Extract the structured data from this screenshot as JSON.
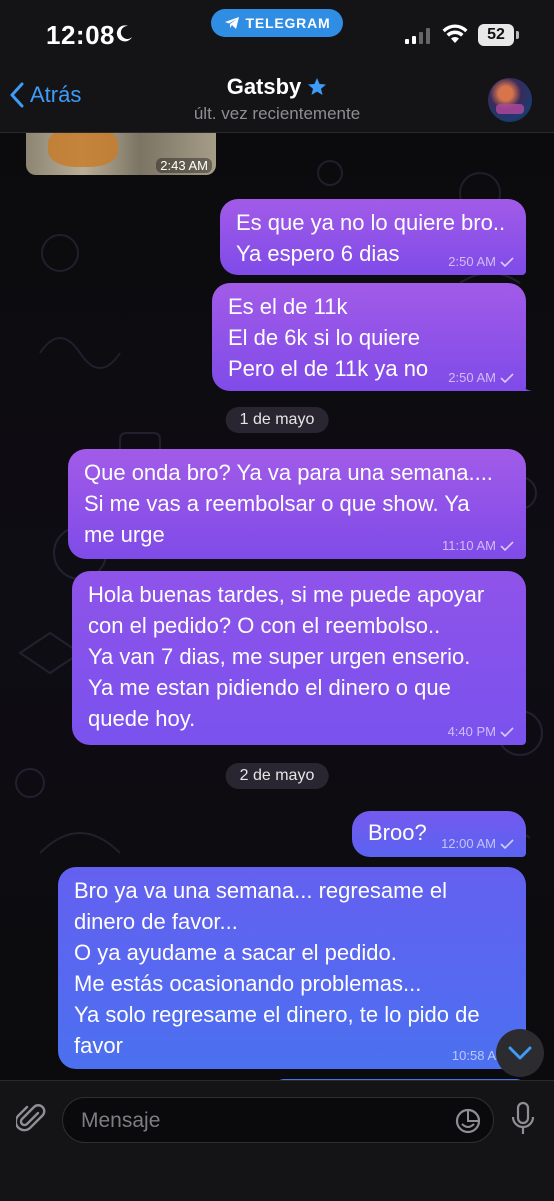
{
  "status_bar": {
    "time": "12:08",
    "telegram_pill": "TELEGRAM",
    "battery": "52"
  },
  "header": {
    "back_label": "Atrás",
    "title": "Gatsby",
    "subtitle": "últ. vez recientemente"
  },
  "photo_message": {
    "time": "2:43 AM"
  },
  "messages": [
    {
      "side": "out",
      "lines": [
        "Es que ya no lo quiere bro..",
        "Ya espero 6 dias"
      ],
      "time": "2:50 AM"
    },
    {
      "side": "out",
      "lines": [
        "Es el de 11k",
        "El de 6k si lo quiere",
        "Pero el de 11k ya no"
      ],
      "time": "2:50 AM"
    },
    {
      "side": "out",
      "lines": [
        "Que onda bro? Ya va para una semana....",
        "Si me vas a reembolsar o que show. Ya",
        "me urge"
      ],
      "time": "11:10 AM"
    },
    {
      "side": "out",
      "lines": [
        "Hola buenas tardes, si me puede apoyar",
        "con el pedido? O con el reembolso..",
        "Ya van 7 dias, me super urgen enserio.",
        "Ya me estan pidiendo el dinero o que",
        "quede hoy."
      ],
      "time": "4:40 PM"
    },
    {
      "side": "out",
      "lines": [
        "Broo?"
      ],
      "time": "12:00 AM"
    },
    {
      "side": "out",
      "lines": [
        "Bro ya va una semana... regresame el",
        "dinero de favor...",
        "O ya ayudame a sacar el pedido.",
        "Me estás ocasionando problemas...",
        "Ya solo regresame el dinero, te lo pido de",
        "favor"
      ],
      "time": "10:58 A"
    }
  ],
  "dates": {
    "d1": "1 de mayo",
    "d2": "2 de mayo"
  },
  "input": {
    "placeholder": "Mensaje"
  },
  "colors": {
    "accent": "#3e9bf7",
    "bubble_purple": "#8f53e9",
    "bubble_blue": "#5a63f0"
  }
}
